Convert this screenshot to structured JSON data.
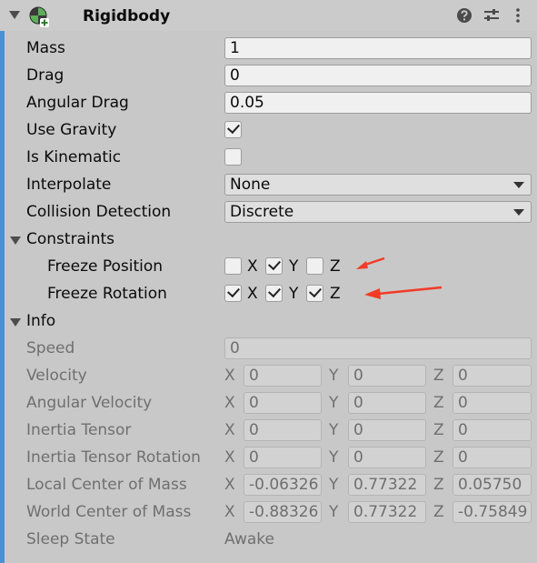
{
  "header": {
    "title": "Rigidbody"
  },
  "icons": {
    "foldout": "triangle-down",
    "component": "rigidbody-icon",
    "help": "question-circle",
    "presets": "sliders",
    "menu": "kebab-vertical",
    "annotation": "red-arrow"
  },
  "colors": {
    "panel_bg": "#c8c8c8",
    "field_bg": "#f0f0f0",
    "readonly_bg": "#d2d2d2",
    "arrow": "#f23a26",
    "modified_bar": "#4a90d6"
  },
  "fields": {
    "mass": {
      "label": "Mass",
      "value": "1"
    },
    "drag": {
      "label": "Drag",
      "value": "0"
    },
    "angular_drag": {
      "label": "Angular Drag",
      "value": "0.05"
    },
    "use_gravity": {
      "label": "Use Gravity",
      "checked": true
    },
    "is_kinematic": {
      "label": "Is Kinematic",
      "checked": false
    },
    "interpolate": {
      "label": "Interpolate",
      "value": "None"
    },
    "collision_detection": {
      "label": "Collision Detection",
      "value": "Discrete"
    }
  },
  "constraints": {
    "label": "Constraints",
    "freeze_position": {
      "label": "Freeze Position",
      "x": false,
      "y": true,
      "z": false
    },
    "freeze_rotation": {
      "label": "Freeze Rotation",
      "x": true,
      "y": true,
      "z": true
    }
  },
  "axes": {
    "x": "X",
    "y": "Y",
    "z": "Z"
  },
  "info": {
    "label": "Info",
    "speed": {
      "label": "Speed",
      "value": "0"
    },
    "velocity": {
      "label": "Velocity",
      "x": "0",
      "y": "0",
      "z": "0"
    },
    "angular_velocity": {
      "label": "Angular Velocity",
      "x": "0",
      "y": "0",
      "z": "0"
    },
    "inertia_tensor": {
      "label": "Inertia Tensor",
      "x": "0",
      "y": "0",
      "z": "0"
    },
    "inertia_tensor_rotation": {
      "label": "Inertia Tensor Rotation",
      "x": "0",
      "y": "0",
      "z": "0"
    },
    "local_center_of_mass": {
      "label": "Local Center of Mass",
      "x": "-0.06326",
      "y": "0.77322",
      "z": "0.05750"
    },
    "world_center_of_mass": {
      "label": "World Center of Mass",
      "x": "-0.88326",
      "y": "0.77322",
      "z": "-0.75849"
    },
    "sleep_state": {
      "label": "Sleep State",
      "value": "Awake"
    }
  }
}
